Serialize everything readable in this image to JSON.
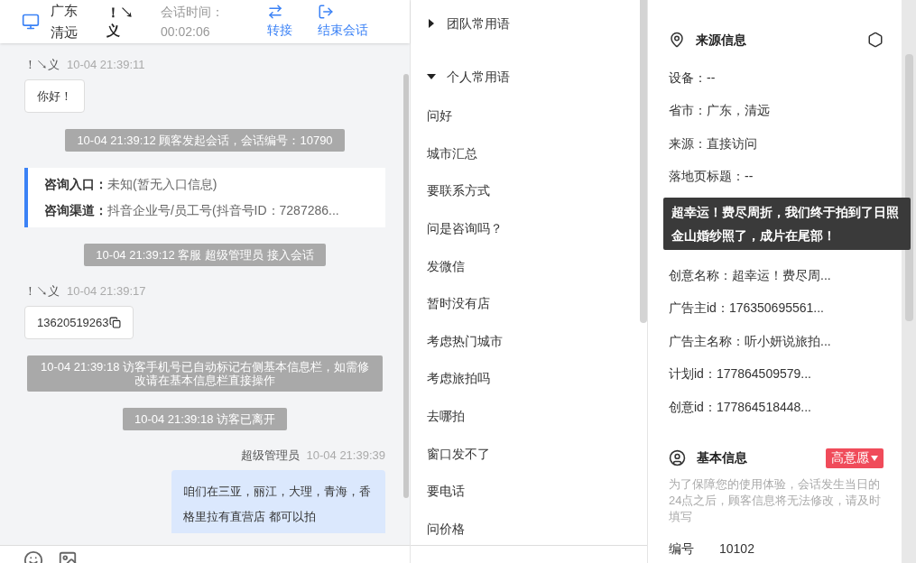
{
  "header": {
    "location": "广东清远",
    "visitor": "！↘义",
    "duration_label": "会话时间：",
    "duration": "00:02:06",
    "actions": [
      {
        "label": "转接",
        "kind": "transfer"
      },
      {
        "label": "结束会话",
        "kind": "end"
      }
    ]
  },
  "messages": [
    {
      "kind": "visitor",
      "name": "！↘义",
      "time": "10-04 21:39:11",
      "text": "你好！",
      "copyable": false
    },
    {
      "kind": "system",
      "text": "10-04 21:39:12 顾客发起会话，会话编号：10790"
    },
    {
      "kind": "card",
      "rows": [
        {
          "label": "咨询入口：",
          "value": "未知(暂无入口信息)"
        },
        {
          "label": "咨询渠道：",
          "value": "抖音企业号/员工号(抖音号ID：7287286..."
        }
      ]
    },
    {
      "kind": "system",
      "text": "10-04 21:39:12 客服 超级管理员 接入会话"
    },
    {
      "kind": "visitor",
      "name": "！↘义",
      "time": "10-04 21:39:17",
      "text": "13620519263",
      "copyable": true
    },
    {
      "kind": "system",
      "text": "10-04 21:39:18 访客手机号已自动标记右侧基本信息栏，如需修改请在基本信息栏直接操作"
    },
    {
      "kind": "system",
      "text": "10-04 21:39:18 访客已离开"
    },
    {
      "kind": "agent",
      "name": "超级管理员",
      "time": "10-04 21:39:39",
      "text": "咱们在三亚，丽江，大理，青海，香格里拉有直营店 都可以拍"
    }
  ],
  "phrases": [
    {
      "title": "团队常用语",
      "expanded": false
    },
    {
      "title": "个人常用语",
      "expanded": true,
      "items": [
        "问好",
        "城市汇总",
        "要联系方式",
        "问是咨询吗？",
        "发微信",
        "暂时没有店",
        "考虑热门城市",
        "考虑旅拍吗",
        "去哪拍",
        "窗口发不了",
        "要电话",
        "问价格"
      ]
    }
  ],
  "source_info": {
    "title": "来源信息",
    "rows": [
      {
        "kind": "row",
        "text": "设备：--"
      },
      {
        "kind": "row",
        "text": "省市：广东，清远"
      },
      {
        "kind": "row",
        "text": "来源：直接访问"
      },
      {
        "kind": "row",
        "text": "落地页标题：--"
      },
      {
        "kind": "covered",
        "text": "超幸运！费尽周折，我们终于拍到了日照金山婚纱照了，成片在尾部！"
      },
      {
        "kind": "row",
        "text": "创意名称：超幸运！费尽周..."
      },
      {
        "kind": "row",
        "text": "广告主id：176350695561..."
      },
      {
        "kind": "row",
        "text": "广告主名称：听小妍说旅拍..."
      },
      {
        "kind": "row",
        "text": "计划id：177864509579..."
      },
      {
        "kind": "row",
        "text": "创意id：177864518448..."
      }
    ]
  },
  "basic_info": {
    "title": "基本信息",
    "tag": "高意愿",
    "notice": "为了保障您的使用体验，会话发生当日的24点之后，顾客信息将无法修改，请及时填写",
    "fields": [
      {
        "label": "编号",
        "value": "10102"
      }
    ]
  }
}
